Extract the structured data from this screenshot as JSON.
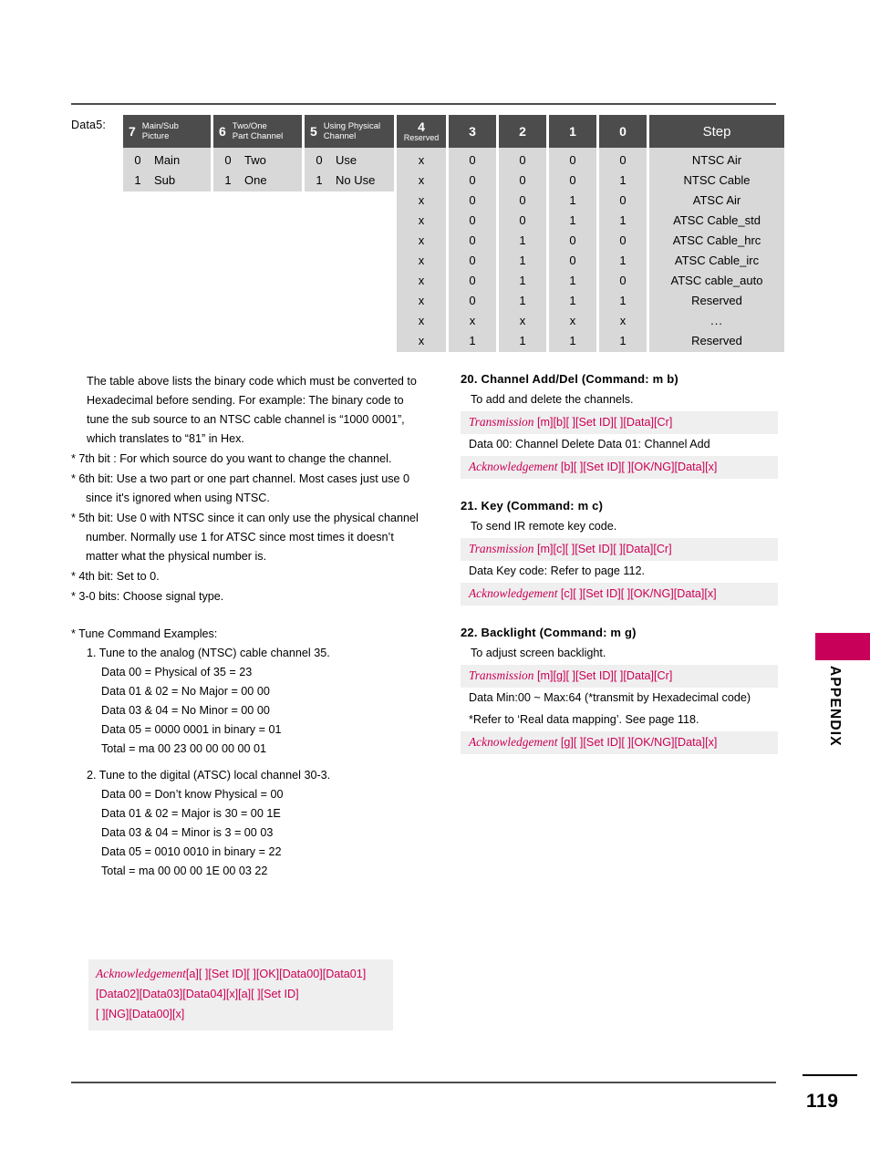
{
  "page": {
    "number": "119",
    "section_tab": "APPENDIX",
    "accent_color": "#c8005a",
    "table_header_color": "#4c4c4c",
    "table_body_color": "#d8d8d8",
    "code_bar_color": "#efefef"
  },
  "data5_table": {
    "label": "Data5:",
    "bit_columns": [
      {
        "num": "7",
        "title_line1": "Main/Sub",
        "title_line2": "Picture",
        "rows": [
          {
            "value": "0",
            "text": "Main"
          },
          {
            "value": "1",
            "text": "Sub"
          }
        ]
      },
      {
        "num": "6",
        "title_line1": "Two/One",
        "title_line2": "Part Channel",
        "rows": [
          {
            "value": "0",
            "text": "Two"
          },
          {
            "value": "1",
            "text": "One"
          }
        ]
      },
      {
        "num": "5",
        "title_line1": "Using Physical",
        "title_line2": "Channel",
        "rows": [
          {
            "value": "0",
            "text": "Use"
          },
          {
            "value": "1",
            "text": "No Use"
          }
        ]
      }
    ],
    "reserved_column": {
      "num": "4",
      "title": "Reserved"
    },
    "signal_columns": [
      "3",
      "2",
      "1",
      "0"
    ],
    "step_header": "Step",
    "signal_rows": [
      {
        "reserved": "x",
        "bits": [
          "0",
          "0",
          "0",
          "0"
        ],
        "step": "NTSC Air"
      },
      {
        "reserved": "x",
        "bits": [
          "0",
          "0",
          "0",
          "1"
        ],
        "step": "NTSC Cable"
      },
      {
        "reserved": "x",
        "bits": [
          "0",
          "0",
          "1",
          "0"
        ],
        "step": "ATSC Air"
      },
      {
        "reserved": "x",
        "bits": [
          "0",
          "0",
          "1",
          "1"
        ],
        "step": "ATSC Cable_std"
      },
      {
        "reserved": "x",
        "bits": [
          "0",
          "1",
          "0",
          "0"
        ],
        "step": "ATSC Cable_hrc"
      },
      {
        "reserved": "x",
        "bits": [
          "0",
          "1",
          "0",
          "1"
        ],
        "step": "ATSC Cable_irc"
      },
      {
        "reserved": "x",
        "bits": [
          "0",
          "1",
          "1",
          "0"
        ],
        "step": "ATSC cable_auto"
      },
      {
        "reserved": "x",
        "bits": [
          "0",
          "1",
          "1",
          "1"
        ],
        "step": "Reserved"
      },
      {
        "reserved": "x",
        "bits": [
          "x",
          "x",
          "x",
          "x"
        ],
        "step": "..."
      },
      {
        "reserved": "x",
        "bits": [
          "1",
          "1",
          "1",
          "1"
        ],
        "step": "Reserved"
      }
    ]
  },
  "left_column": {
    "intro": "The table above lists the binary code which must be converted to Hexadecimal before sending. For example: The binary code to tune the sub source to an NTSC cable channel is “1000 0001”, which translates to “81” in Hex.",
    "bullets": [
      "* 7th bit : For which source do you want to change the channel.",
      "* 6th bit: Use a two part or one part channel. Most cases just use 0 since it's ignored when using NTSC.",
      "* 5th bit: Use 0 with NTSC since it can only use the physical channel number. Normally use 1 for ATSC since most times it doesn’t  matter what the physical number is.",
      "* 4th bit: Set to 0.",
      "*  3-0 bits: Choose signal type."
    ],
    "examples_title": "*  Tune Command Examples:",
    "example1": {
      "heading": "1. Tune to the analog (NTSC) cable channel 35.",
      "lines": [
        "Data  00 = Physical of 35 = 23",
        "Data 01 & 02 = No Major = 00 00",
        "Data 03 & 04 = No Minor = 00 00",
        "Data 05 = 0000 0001 in binary = 01",
        "Total = ma 00 23 00 00 00 00 01"
      ]
    },
    "example2": {
      "heading": "2. Tune to the digital (ATSC) local channel 30-3.",
      "lines": [
        "Data  00 = Don’t know Physical = 00",
        "Data 01 & 02 = Major is 30 = 00 1E",
        "Data 03 & 04 = Minor is 3 = 00 03",
        "Data 05 = 0010 0010 in binary = 22",
        "Total = ma 00 00 00 1E 00 03 22"
      ]
    },
    "acknowledgement_box": {
      "label": "Acknowledgement",
      "line1": "[a][ ][Set ID][ ][OK][Data00][Data01]",
      "line2": "[Data02][Data03][Data04][x][a][ ][Set ID]",
      "line3": "[ ][NG][Data00][x]"
    }
  },
  "right_column": {
    "sections": [
      {
        "heading": "20. Channel Add/Del (Command: m b)",
        "subtitle": "To add and delete the channels.",
        "transmission_label": "Transmission",
        "transmission_code": "[m][b][ ][Set ID][ ][Data][Cr]",
        "notes": [
          "Data 00: Channel Delete     Data 01: Channel Add"
        ],
        "ack_label": "Acknowledgement",
        "ack_code": "[b][ ][Set ID][ ][OK/NG][Data][x]"
      },
      {
        "heading": "21. Key (Command: m c)",
        "subtitle": "To send IR remote key code.",
        "transmission_label": "Transmission",
        "transmission_code": "[m][c][ ][Set ID][ ][Data][Cr]",
        "notes": [
          "Data Key code: Refer to page 112."
        ],
        "ack_label": "Acknowledgement",
        "ack_code": "[c][ ][Set ID][ ][OK/NG][Data][x]"
      },
      {
        "heading": "22. Backlight (Command: m g)",
        "subtitle": "To adjust screen backlight.",
        "transmission_label": "Transmission",
        "transmission_code": "[m][g][ ][Set ID][ ][Data][Cr]",
        "notes": [
          "Data Min:00 ~ Max:64 (*transmit by Hexadecimal code)",
          "*Refer to ‘Real data mapping’. See page 118."
        ],
        "ack_label": "Acknowledgement",
        "ack_code": "[g][ ][Set ID][ ][OK/NG][Data][x]"
      }
    ]
  }
}
